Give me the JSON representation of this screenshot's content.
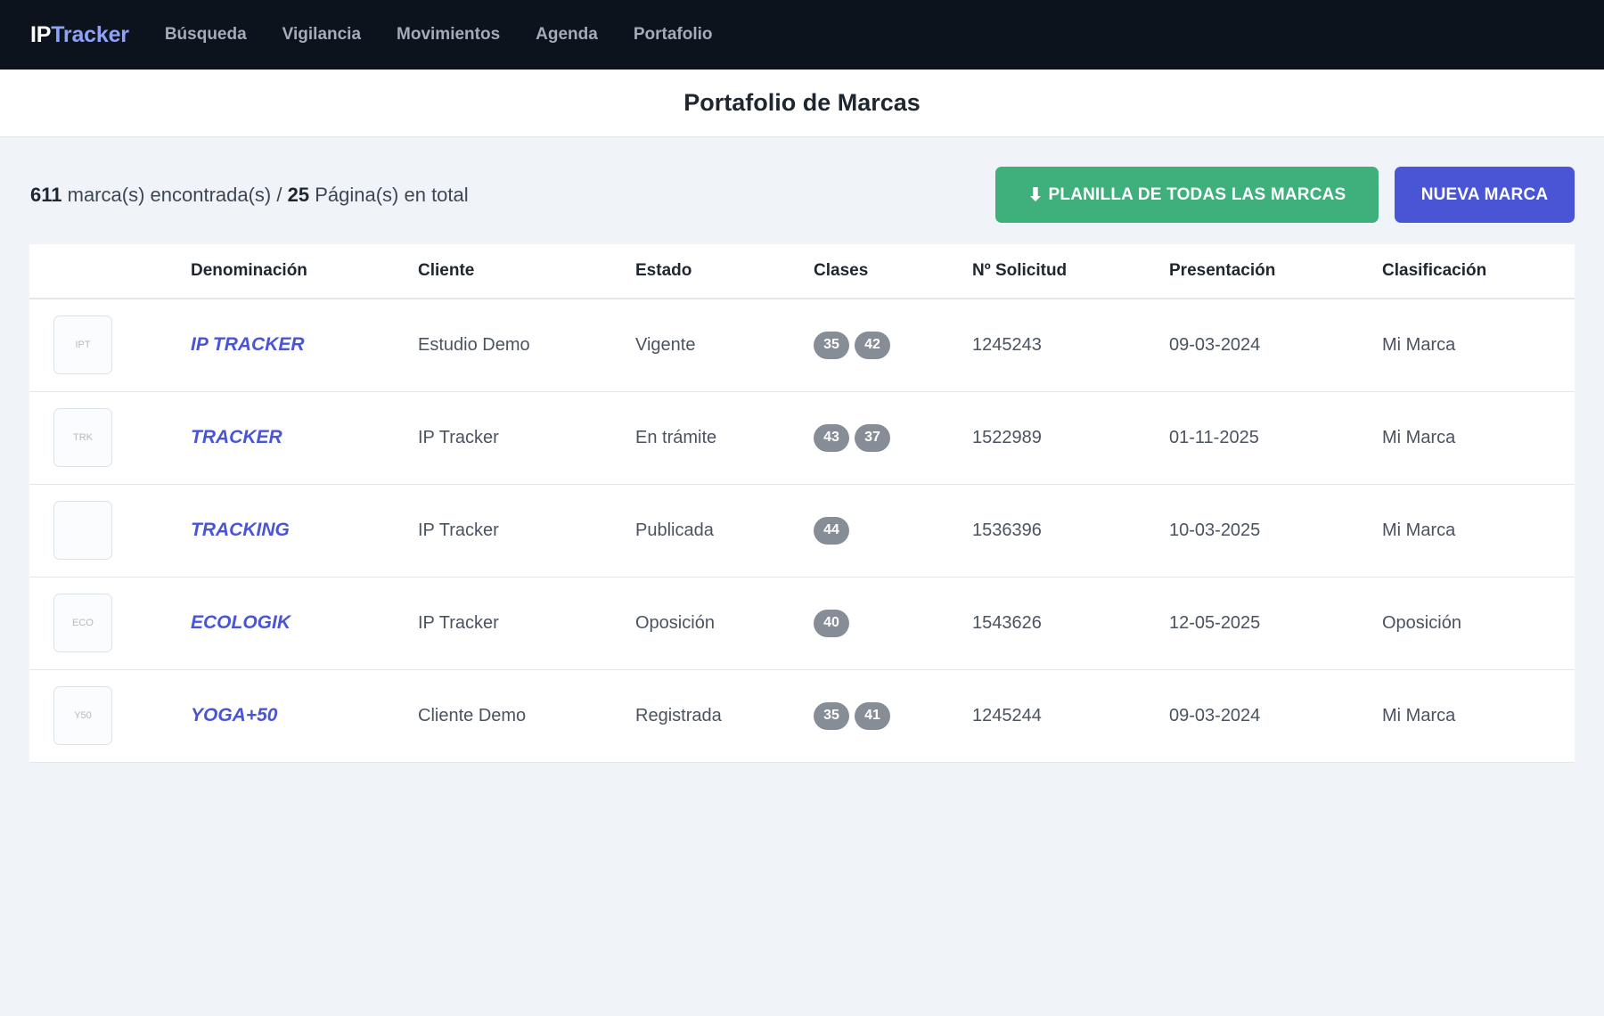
{
  "brand": {
    "ip": "IP",
    "tracker": "Tracker"
  },
  "nav": [
    {
      "label": "Búsqueda"
    },
    {
      "label": "Vigilancia"
    },
    {
      "label": "Movimientos"
    },
    {
      "label": "Agenda"
    },
    {
      "label": "Portafolio"
    }
  ],
  "page_title": "Portafolio de Marcas",
  "summary": {
    "count": "611",
    "count_text": "marca(s) encontrada(s) /",
    "pages": "25",
    "pages_text": "Página(s) en total"
  },
  "buttons": {
    "download_icon": "⬇",
    "download_label": "PLANILLA DE TODAS LAS MARCAS",
    "new_label": "NUEVA MARCA"
  },
  "table": {
    "headers": [
      "",
      "Denominación",
      "Cliente",
      "Estado",
      "Clases",
      "Nº Solicitud",
      "Presentación",
      "Clasificación"
    ],
    "rows": [
      {
        "logo": "IPT",
        "denominacion": "IP TRACKER",
        "cliente": "Estudio Demo",
        "estado": "Vigente",
        "clases": [
          "35",
          "42"
        ],
        "solicitud": "1245243",
        "presentacion": "09-03-2024",
        "clasificacion": "Mi Marca"
      },
      {
        "logo": "TRK",
        "denominacion": "TRACKER",
        "cliente": "IP Tracker",
        "estado": "En trámite",
        "clases": [
          "43",
          "37"
        ],
        "solicitud": "1522989",
        "presentacion": "01-11-2025",
        "clasificacion": "Mi Marca"
      },
      {
        "logo": "",
        "denominacion": "TRACKING",
        "cliente": "IP Tracker",
        "estado": "Publicada",
        "clases": [
          "44"
        ],
        "solicitud": "1536396",
        "presentacion": "10-03-2025",
        "clasificacion": "Mi Marca"
      },
      {
        "logo": "ECO",
        "denominacion": "ECOLOGIK",
        "cliente": "IP Tracker",
        "estado": "Oposición",
        "clases": [
          "40"
        ],
        "solicitud": "1543626",
        "presentacion": "12-05-2025",
        "clasificacion": "Oposición"
      },
      {
        "logo": "Y50",
        "denominacion": "YOGA+50",
        "cliente": "Cliente Demo",
        "estado": "Registrada",
        "clases": [
          "35",
          "41"
        ],
        "solicitud": "1245244",
        "presentacion": "09-03-2024",
        "clasificacion": "Mi Marca"
      }
    ]
  },
  "colors": {
    "nav_bg": "#0d131c",
    "brand_accent": "#8da2fb",
    "primary": "#4a55d6",
    "success": "#3fb07c",
    "badge": "#878d96"
  }
}
